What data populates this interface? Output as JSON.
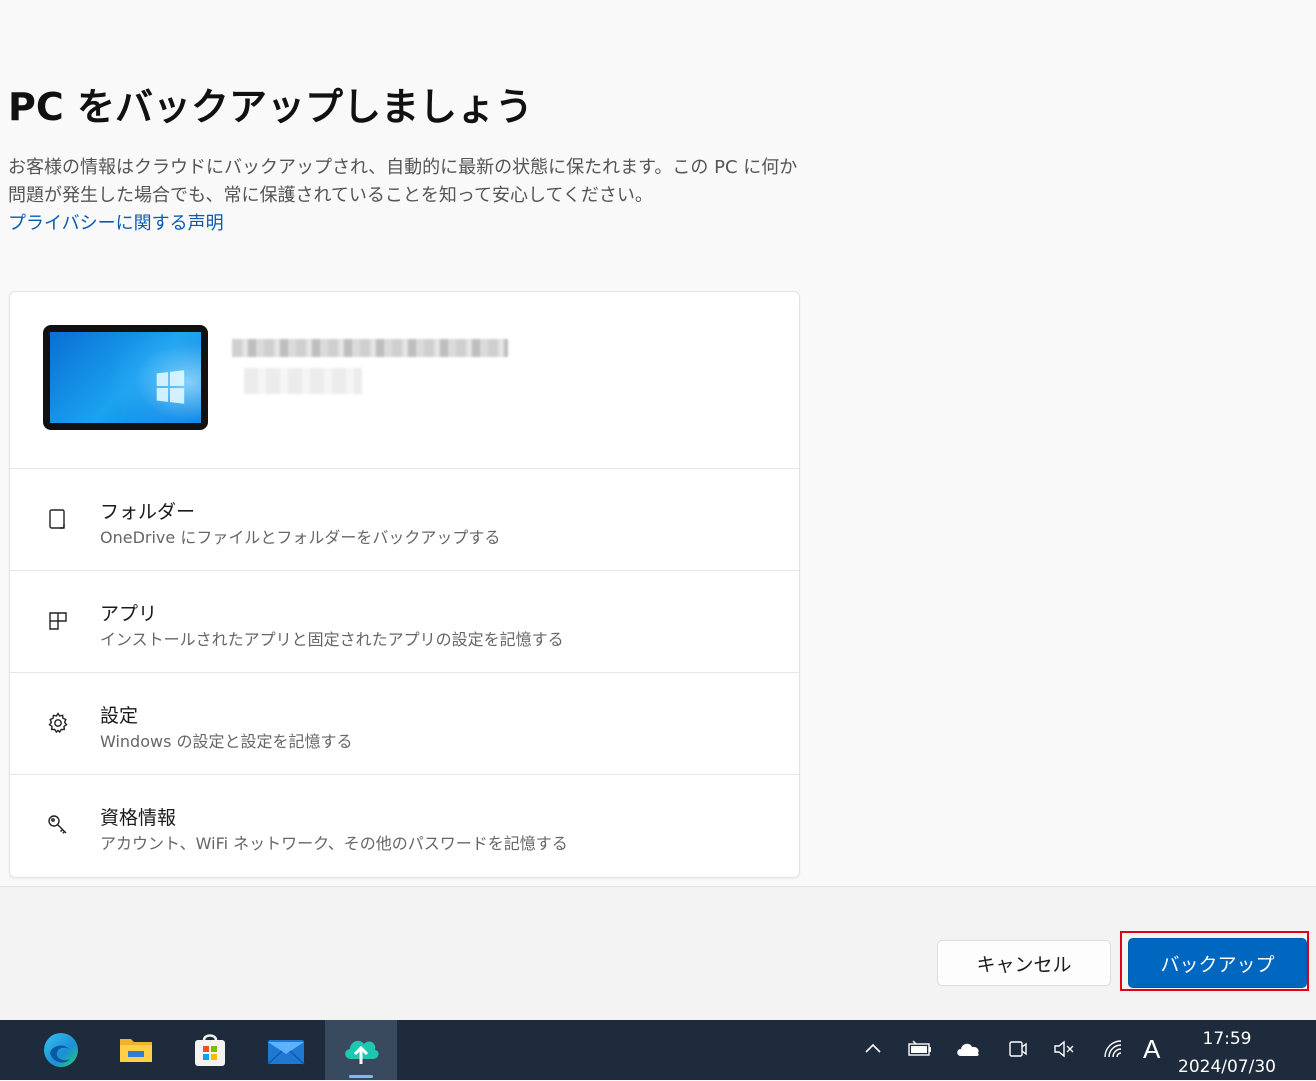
{
  "page": {
    "title": "PC をバックアップしましょう",
    "description": "お客様の情報はクラウドにバックアップされ、自動的に最新の状態に保たれます。この PC に何か問題が発生した場合でも、常に保護されていることを知って安心してください。",
    "privacy_link": "プライバシーに関する声明"
  },
  "options": [
    {
      "label": "フォルダー",
      "sub": "OneDrive にファイルとフォルダーをバックアップする",
      "icon": "folder-icon"
    },
    {
      "label": "アプリ",
      "sub": "インストールされたアプリと固定されたアプリの設定を記憶する",
      "icon": "apps-icon"
    },
    {
      "label": "設定",
      "sub": "Windows の設定と設定を記憶する",
      "icon": "gear-icon"
    },
    {
      "label": "資格情報",
      "sub": "アカウント、WiFi ネットワーク、その他のパスワードを記憶する",
      "icon": "key-icon"
    }
  ],
  "buttons": {
    "cancel": "キャンセル",
    "backup": "バックアップ"
  },
  "taskbar": {
    "apps": [
      "edge-icon",
      "file-explorer-icon",
      "store-icon",
      "mail-icon",
      "backup-app-icon"
    ],
    "ime": "A",
    "time": "17:59",
    "date": "2024/07/30"
  },
  "colors": {
    "accent": "#0067c0",
    "link": "#0a5bb0",
    "highlight": "#e0001a",
    "taskbar": "#1e2b3c"
  }
}
